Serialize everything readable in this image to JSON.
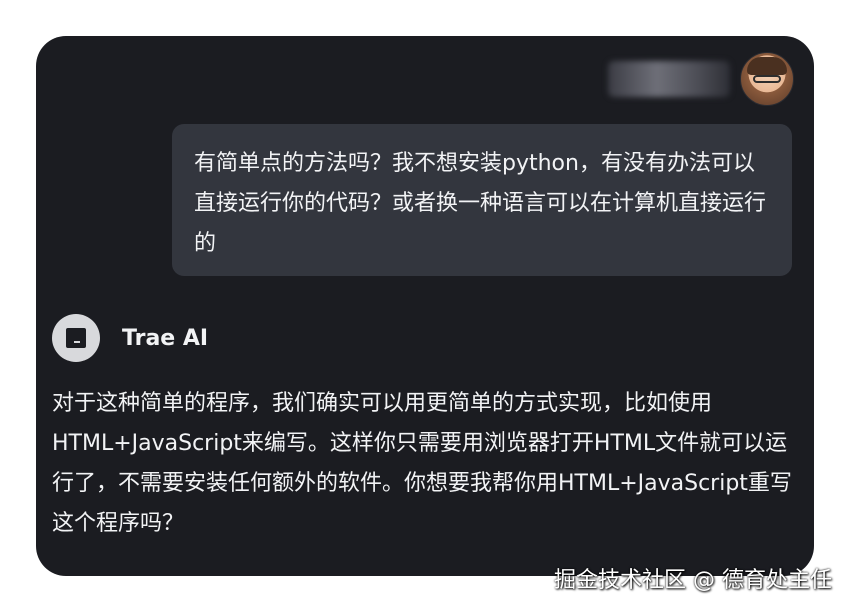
{
  "user": {
    "message": "有简单点的方法吗？我不想安装python，有没有办法可以直接运行你的代码？或者换一种语言可以在计算机直接运行的"
  },
  "assistant": {
    "name": "Trae AI",
    "message": "对于这种简单的程序，我们确实可以用更简单的方式实现，比如使用HTML+JavaScript来编写。这样你只需要用浏览器打开HTML文件就可以运行了，不需要安装任何额外的软件。你想要我帮你用HTML+JavaScript重写这个程序吗？"
  },
  "watermark": "掘金技术社区 @ 德育处主任"
}
